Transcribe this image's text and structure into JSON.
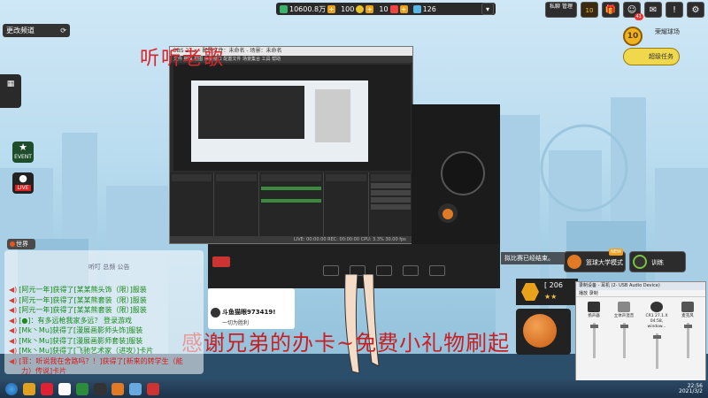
{
  "hud": {
    "points": "10600.8万",
    "coins": "100",
    "tickets": "10",
    "energy": "126"
  },
  "top_right": {
    "manage_label": "私聊\n管理",
    "level_badge": "10",
    "notification_count": "41"
  },
  "left_menu": {
    "change_channel_label": "更改频道",
    "event_label": "EVENT",
    "live_label": "LIVE"
  },
  "player": {
    "level": "10",
    "server_name": "荣耀球场",
    "task_label": "超级任务"
  },
  "captions": {
    "top": "听听老歌",
    "bottom": "感谢兄弟的办卡~免费小礼物刷起"
  },
  "chat": {
    "tab_label": "世界",
    "header": "听叮 总频 公告",
    "lines": [
      {
        "text": "[阿元一年]获得了[某某熊头饰（限）]服装",
        "style": "green"
      },
      {
        "text": "[阿元一年]获得了[某某熊套装（限）]服装",
        "style": "green"
      },
      {
        "text": "[阿元一年]获得了[某某熊套装（限）]服装",
        "style": "green"
      },
      {
        "text": "[●]：有多远枪我家多远？ 登录游戏",
        "style": "green"
      },
      {
        "text": "[Mk丶Mu]获得了[漫展画影师头饰]服装",
        "style": "green"
      },
      {
        "text": "[Mk丶Mu]获得了[漫展画影师套装]服装",
        "style": "green"
      },
      {
        "text": "[Mk丶Mu]获得了[飞驰艺术家（进攻）]卡片",
        "style": "green"
      },
      {
        "text": "[菲：听说我在舍路吗？！]获得了[新来的转学生（能",
        "style": "red"
      },
      {
        "text": "力）传说]卡片",
        "style": "red"
      }
    ]
  },
  "obs": {
    "title": "OBS 27.x - 配置文件：未命名 - 场景：未命名",
    "status": "LIVE: 00:00:00  REC: 00:00:00  CPU: 3.3%  30.00 fps"
  },
  "anchor": {
    "name": "斗鱼猫眼973419!",
    "sub": "一切为胜利"
  },
  "game": {
    "notice": "拟比赛已经结束。",
    "mode_college": "篮球大学模式",
    "mode_college_tag": "NEW",
    "mode_train": "训练",
    "rank_value": "206"
  },
  "sound_dialog": {
    "title": "录制设备 - 耳机 (2- USB Audio Device)",
    "devices": [
      "扬声器",
      "立体声混音",
      "CR1 27.1.X 04:58, window...",
      "麦克风"
    ]
  },
  "taskbar": {
    "time": "22:56",
    "date": "2021/3/2"
  }
}
